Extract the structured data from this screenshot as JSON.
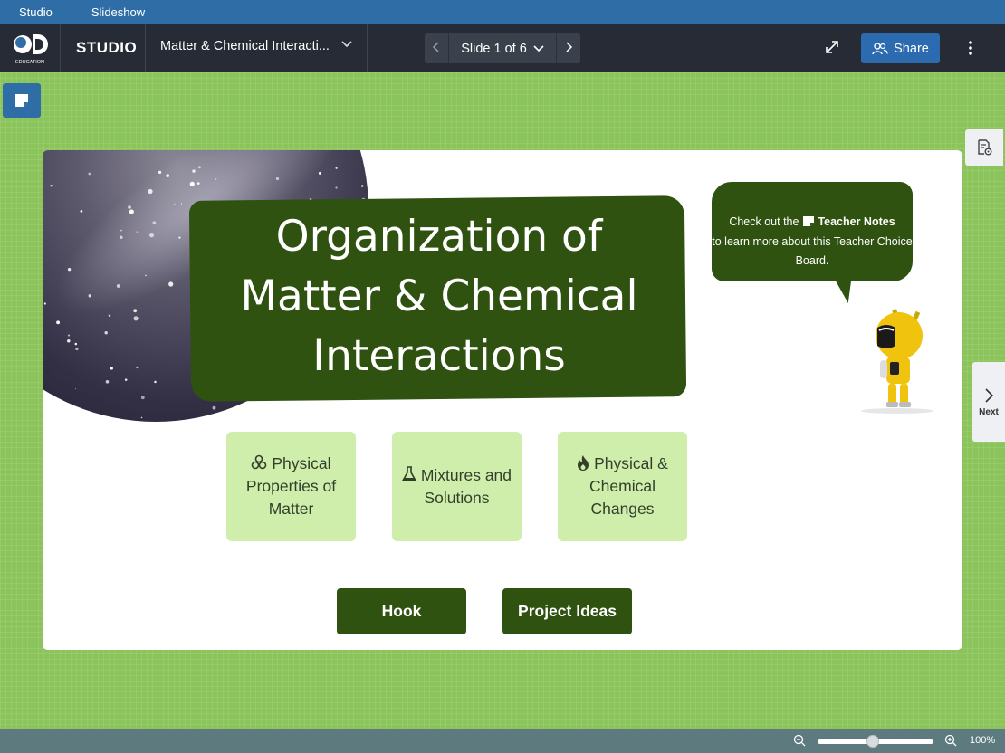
{
  "tabs": {
    "studio": "Studio",
    "slideshow": "Slideshow"
  },
  "header": {
    "logo_text": "EDUCATION",
    "app_name": "STUDIO",
    "doc_title": "Matter & Chemical Interacti...",
    "slide_indicator": "Slide 1 of 6",
    "share_label": "Share"
  },
  "slide": {
    "title": "Organization of Matter & Chemical Interactions",
    "bubble": {
      "prefix": "Check out the",
      "notes": "Teacher Notes",
      "suffix": "to learn more about this Teacher Choice Board."
    },
    "cards": [
      {
        "icon": "atom-icon",
        "label": "Physical Properties of Matter"
      },
      {
        "icon": "flask-icon",
        "label": "Mixtures and Solutions"
      },
      {
        "icon": "fire-icon",
        "label": "Physical & Chemical Changes"
      }
    ],
    "buttons": {
      "hook": "Hook",
      "project": "Project Ideas"
    }
  },
  "side": {
    "next_label": "Next"
  },
  "footer": {
    "zoom_level": "100%",
    "zoom_fraction": 0.48
  },
  "colors": {
    "accent": "#2e6da6",
    "canvas": "#8bc45a",
    "dark_green": "#2f5210",
    "card_green": "#cfeeac"
  }
}
